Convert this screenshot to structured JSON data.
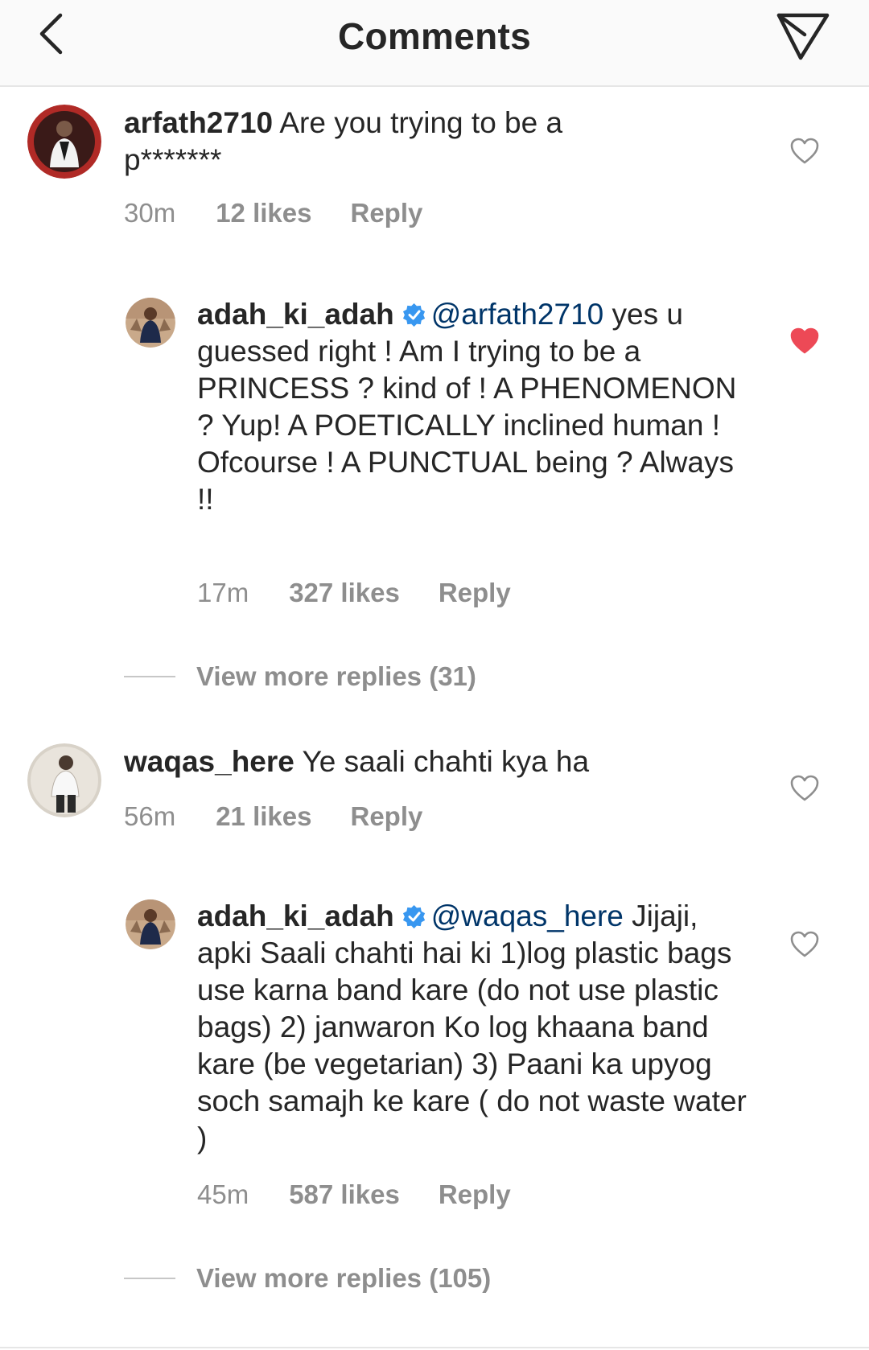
{
  "header": {
    "title": "Comments"
  },
  "comments": [
    {
      "username": "arfath2710",
      "text": "Are you trying to be a p*******",
      "time": "30m",
      "likes": "12 likes",
      "reply": "Reply",
      "liked": false,
      "replies": [
        {
          "username": "adah_ki_adah",
          "verified": true,
          "mention": "@arfath2710",
          "text": "yes u guessed right ! Am I trying to be a PRINCESS ? kind of ! A PHENOMENON ? Yup! A POETICALLY inclined human ! Ofcourse ! A PUNCTUAL being ? Always !!",
          "time": "17m",
          "likes": "327 likes",
          "reply": "Reply",
          "liked": true
        }
      ],
      "view_more": "View more replies (31)"
    },
    {
      "username": "waqas_here",
      "text": "Ye saali chahti kya ha",
      "time": "56m",
      "likes": "21 likes",
      "reply": "Reply",
      "liked": false,
      "replies": [
        {
          "username": "adah_ki_adah",
          "verified": true,
          "mention": "@waqas_here",
          "text": "Jijaji, apki Saali chahti hai ki 1)log plastic bags use karna band kare (do not use plastic bags) 2) janwaron Ko log khaana band kare (be vegetarian) 3) Paani ka upyog soch samajh ke kare ( do not waste water )",
          "time": "45m",
          "likes": "587 likes",
          "reply": "Reply",
          "liked": false
        }
      ],
      "view_more": "View more replies (105)"
    }
  ],
  "colors": {
    "text": "#262626",
    "meta": "#8e8e8e",
    "mention": "#003569",
    "verified": "#3897f0",
    "liked_heart": "#ed4956",
    "header_bg": "#fafafa"
  },
  "icons": {
    "back": "chevron-left-icon",
    "share": "paper-plane-icon",
    "like": "heart-icon",
    "verified": "verified-badge-icon"
  }
}
